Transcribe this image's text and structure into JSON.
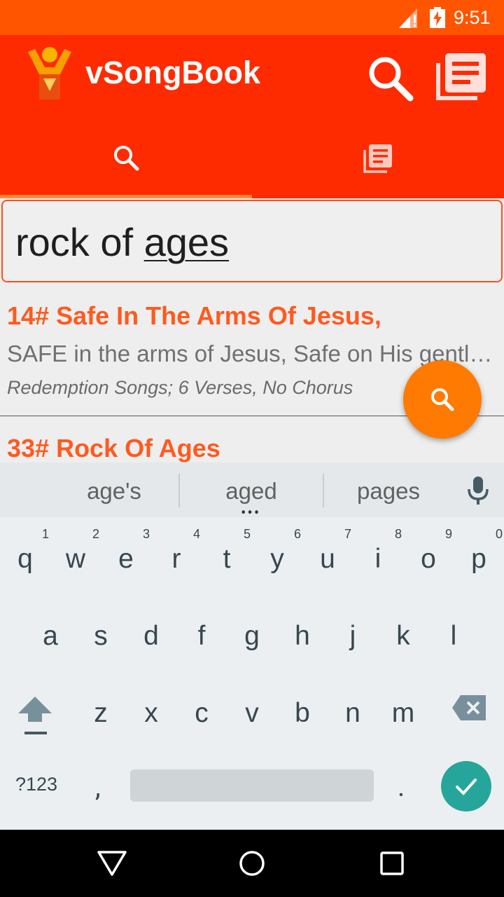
{
  "status_bar": {
    "time": "9:51",
    "icons": [
      "signal-icon",
      "battery-charging-icon"
    ]
  },
  "app_bar": {
    "title": "vSongBook",
    "actions": [
      "search-icon",
      "songbooks-icon"
    ]
  },
  "tabs": [
    {
      "icon": "search-icon",
      "selected": true
    },
    {
      "icon": "songbooks-icon",
      "selected": false
    }
  ],
  "search": {
    "typed": "rock of ",
    "composing": "ages"
  },
  "results": [
    {
      "title": "14# Safe In The Arms Of Jesus,",
      "snippet": "SAFE in the arms of Jesus, Safe on His gentle breast,",
      "meta": "Redemption Songs; 6 Verses, No Chorus"
    },
    {
      "title": "33# Rock Of Ages"
    }
  ],
  "keyboard": {
    "suggestions": [
      "age's",
      "aged",
      "pages"
    ],
    "row1": [
      {
        "k": "q",
        "h": "1"
      },
      {
        "k": "w",
        "h": "2"
      },
      {
        "k": "e",
        "h": "3"
      },
      {
        "k": "r",
        "h": "4"
      },
      {
        "k": "t",
        "h": "5"
      },
      {
        "k": "y",
        "h": "6"
      },
      {
        "k": "u",
        "h": "7"
      },
      {
        "k": "i",
        "h": "8"
      },
      {
        "k": "o",
        "h": "9"
      },
      {
        "k": "p",
        "h": "0"
      }
    ],
    "row2": [
      "a",
      "s",
      "d",
      "f",
      "g",
      "h",
      "j",
      "k",
      "l"
    ],
    "row3": [
      "z",
      "x",
      "c",
      "v",
      "b",
      "n",
      "m"
    ],
    "symbols_label": "?123",
    "comma": ",",
    "period": "."
  },
  "colors": {
    "status_bar": "#ff5500",
    "app_bar": "#ff2b00",
    "accent": "#ff5a1f",
    "fab": "#ff7a00",
    "enter": "#26a69a"
  }
}
